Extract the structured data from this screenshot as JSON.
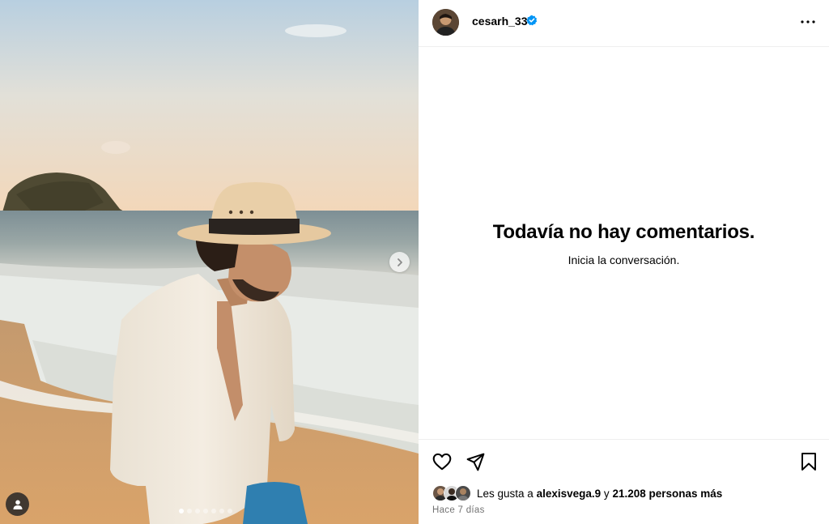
{
  "post": {
    "author": {
      "username": "cesarh_33",
      "verified": true,
      "avatar_icon": "profile-photo"
    },
    "media": {
      "carousel_count": 7,
      "active_index": 0,
      "next_icon": "chevron-right-icon",
      "tag_icon": "user-tag-icon"
    },
    "comments": {
      "empty_title": "Todavía no hay comentarios.",
      "empty_subtitle": "Inicia la conversación."
    },
    "actions": {
      "like_icon": "heart-icon",
      "share_icon": "send-icon",
      "save_icon": "bookmark-icon",
      "more_icon": "more-horizontal-icon"
    },
    "likes": {
      "prefix": "Les gusta a",
      "first_user": "alexisvega.9",
      "connector": "y",
      "others": "21.208 personas más"
    },
    "timestamp": "Hace 7 días"
  },
  "colors": {
    "verified": "#0095f6",
    "secondary_text": "#737373",
    "divider": "#efefef"
  }
}
